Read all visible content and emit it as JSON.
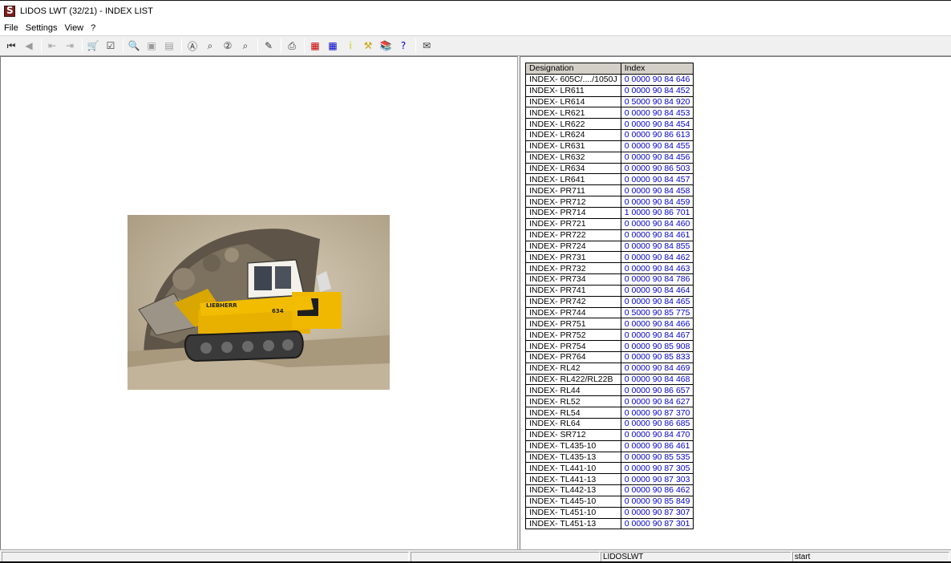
{
  "window": {
    "title": "LIDOS LWT (32/21) - INDEX LIST"
  },
  "menu": [
    "File",
    "Settings",
    "View",
    "?"
  ],
  "toolbar": [
    {
      "icon": "first-record-icon",
      "glyph": "⏮",
      "enabled": true
    },
    {
      "icon": "previous-record-icon",
      "glyph": "◀",
      "enabled": false
    },
    {
      "icon": "page-back-icon",
      "glyph": "⇤",
      "enabled": false
    },
    {
      "icon": "page-forward-icon",
      "glyph": "⇥",
      "enabled": false
    },
    {
      "icon": "cart-icon",
      "glyph": "🛒",
      "enabled": true
    },
    {
      "icon": "checklist-icon",
      "glyph": "☑",
      "enabled": true
    },
    {
      "icon": "zoom-in-icon",
      "glyph": "🔍",
      "enabled": false
    },
    {
      "icon": "fit-page-icon",
      "glyph": "▣",
      "enabled": false
    },
    {
      "icon": "fit-width-icon",
      "glyph": "▤",
      "enabled": false
    },
    {
      "icon": "search-text-icon",
      "glyph": "Ⓐ",
      "enabled": true
    },
    {
      "icon": "search-next-icon",
      "glyph": "⌕",
      "enabled": true
    },
    {
      "icon": "search-number-icon",
      "glyph": "②",
      "enabled": true
    },
    {
      "icon": "search-number-next-icon",
      "glyph": "⌕",
      "enabled": true
    },
    {
      "icon": "edit-note-icon",
      "glyph": "✎",
      "enabled": true
    },
    {
      "icon": "print-icon",
      "glyph": "⎙",
      "enabled": true
    },
    {
      "icon": "grid-red-icon",
      "glyph": "▦",
      "enabled": true,
      "color": "#cc0000"
    },
    {
      "icon": "grid-blue-icon",
      "glyph": "▦",
      "enabled": true,
      "color": "#0000cc"
    },
    {
      "icon": "info-icon",
      "glyph": "i",
      "enabled": true,
      "color": "#cccc00"
    },
    {
      "icon": "tools-icon",
      "glyph": "⚒",
      "enabled": true,
      "color": "#c8a000"
    },
    {
      "icon": "books-icon",
      "glyph": "📚",
      "enabled": true
    },
    {
      "icon": "help-lidos-icon",
      "glyph": "?",
      "enabled": true,
      "color": "#0000cc"
    },
    {
      "icon": "mail-icon",
      "glyph": "✉",
      "enabled": true
    }
  ],
  "table": {
    "headers": [
      "Designation",
      "Index"
    ],
    "rows": [
      [
        "INDEX- 605C/..../1050J",
        "0 0000 90 84 646"
      ],
      [
        "INDEX- LR611",
        "0 0000 90 84 452"
      ],
      [
        "INDEX- LR614",
        "0 5000 90 84 920"
      ],
      [
        "INDEX- LR621",
        "0 0000 90 84 453"
      ],
      [
        "INDEX- LR622",
        "0 0000 90 84 454"
      ],
      [
        "INDEX- LR624",
        "0 0000 90 86 613"
      ],
      [
        "INDEX- LR631",
        "0 0000 90 84 455"
      ],
      [
        "INDEX- LR632",
        "0 0000 90 84 456"
      ],
      [
        "INDEX- LR634",
        "0 0000 90 86 503"
      ],
      [
        "INDEX- LR641",
        "0 0000 90 84 457"
      ],
      [
        "INDEX- PR711",
        "0 0000 90 84 458"
      ],
      [
        "INDEX- PR712",
        "0 0000 90 84 459"
      ],
      [
        "INDEX- PR714",
        "1 0000 90 86 701"
      ],
      [
        "INDEX- PR721",
        "0 0000 90 84 460"
      ],
      [
        "INDEX- PR722",
        "0 0000 90 84 461"
      ],
      [
        "INDEX- PR724",
        "0 0000 90 84 855"
      ],
      [
        "INDEX- PR731",
        "0 0000 90 84 462"
      ],
      [
        "INDEX- PR732",
        "0 0000 90 84 463"
      ],
      [
        "INDEX- PR734",
        "0 0000 90 84 786"
      ],
      [
        "INDEX- PR741",
        "0 0000 90 84 464"
      ],
      [
        "INDEX- PR742",
        "0 0000 90 84 465"
      ],
      [
        "INDEX- PR744",
        "0 5000 90 85 775"
      ],
      [
        "INDEX- PR751",
        "0 0000 90 84 466"
      ],
      [
        "INDEX- PR752",
        "0 0000 90 84 467"
      ],
      [
        "INDEX- PR754",
        "0 0000 90 85 908"
      ],
      [
        "INDEX- PR764",
        "0 0000 90 85 833"
      ],
      [
        "INDEX- RL42",
        "0 0000 90 84 469"
      ],
      [
        "INDEX- RL422/RL22B",
        "0 0000 90 84 468"
      ],
      [
        "INDEX- RL44",
        "0 0000 90 86 657"
      ],
      [
        "INDEX- RL52",
        "0 0000 90 84 627"
      ],
      [
        "INDEX- RL54",
        "0 0000 90 87 370"
      ],
      [
        "INDEX- RL64",
        "0 0000 90 86 685"
      ],
      [
        "INDEX- SR712",
        "0 0000 90 84 470"
      ],
      [
        "INDEX- TL435-10",
        "0 0000 90 86 461"
      ],
      [
        "INDEX- TL435-13",
        "0 0000 90 85 535"
      ],
      [
        "INDEX- TL441-10",
        "0 0000 90 87 305"
      ],
      [
        "INDEX- TL441-13",
        "0 0000 90 87 303"
      ],
      [
        "INDEX- TL442-13",
        "0 0000 90 86 462"
      ],
      [
        "INDEX- TL445-10",
        "0 0000 90 85 849"
      ],
      [
        "INDEX- TL451-10",
        "0 0000 90 87 307"
      ],
      [
        "INDEX- TL451-13",
        "0 0000 90 87 301"
      ]
    ]
  },
  "photo": {
    "brand": "LIEBHERR",
    "model": "634"
  },
  "status": {
    "center": "LIDOSLWT",
    "right": "start"
  }
}
